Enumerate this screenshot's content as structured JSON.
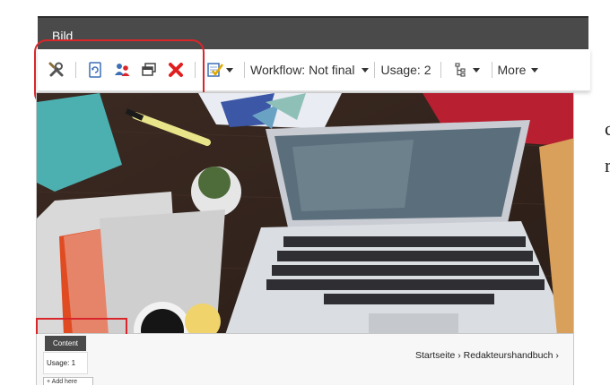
{
  "panel": {
    "title": "Bild"
  },
  "toolbar": {
    "icons": [
      "tools-icon",
      "reload-icon",
      "users-icon",
      "window-icon",
      "delete-icon",
      "approve-icon",
      "tree-icon"
    ],
    "workflow_label": "Workflow: Not final",
    "usage_label": "Usage: 2",
    "more_label": "More"
  },
  "page": {
    "content_badge": "Content",
    "usage_badge": "Usage: 1",
    "add_here": "+ Add here",
    "breadcrumb": "Startseite › Redakteurshandbuch ›",
    "side_chars": [
      "c",
      "r"
    ]
  },
  "colors": {
    "accent_red": "#d9262b",
    "title_bg": "#4a4a4a",
    "delete_red": "#e02020"
  }
}
